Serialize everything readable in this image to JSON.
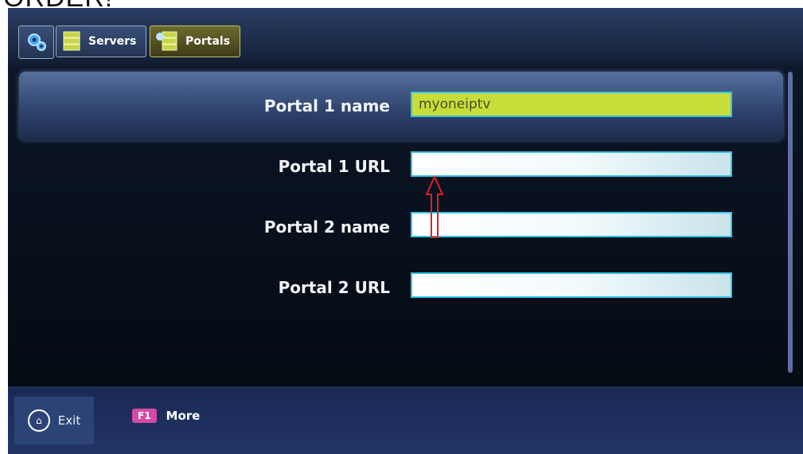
{
  "caption": "ORDER!",
  "tabs": [
    {
      "id": "settings",
      "label": ""
    },
    {
      "id": "servers",
      "label": "Servers"
    },
    {
      "id": "portals",
      "label": "Portals"
    }
  ],
  "fields": [
    {
      "label": "Portal 1 name",
      "value": "myoneiptv",
      "active": true
    },
    {
      "label": "Portal 1 URL",
      "value": "",
      "active": false
    },
    {
      "label": "Portal 2 name",
      "value": "",
      "active": false
    },
    {
      "label": "Portal 2 URL",
      "value": "",
      "active": false
    }
  ],
  "footer": {
    "exit_label": "Exit",
    "f1_key": "F1",
    "more_label": "More"
  },
  "colors": {
    "active_field": "#c8dd3a",
    "field_border": "#35c3e6",
    "arrow": "#e02020"
  }
}
